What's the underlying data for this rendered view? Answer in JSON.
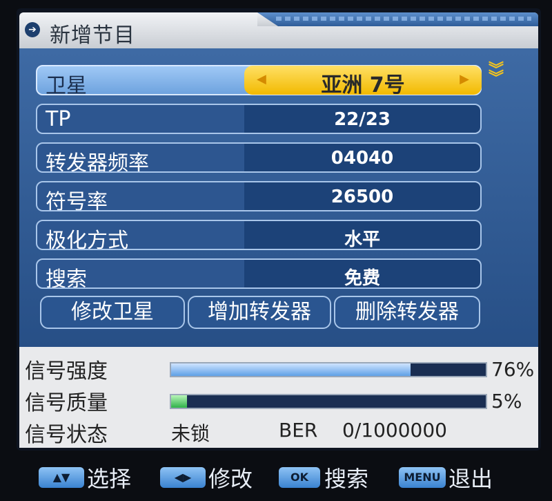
{
  "title": "新增节目",
  "rows": [
    {
      "label": "卫星",
      "value": "亚洲 7号"
    },
    {
      "label": "TP",
      "value": "22/23"
    },
    {
      "label": "转发器频率",
      "value": "04040"
    },
    {
      "label": "符号率",
      "value": "26500"
    },
    {
      "label": "极化方式",
      "value": "水平"
    },
    {
      "label": "搜索",
      "value": "免费"
    }
  ],
  "buttons": {
    "edit_satellite": "修改卫星",
    "add_transponder": "增加转发器",
    "delete_transponder": "删除转发器"
  },
  "signal": {
    "strength_label": "信号强度",
    "strength_pct": "76%",
    "strength_value": 0.76,
    "quality_label": "信号质量",
    "quality_pct": "5%",
    "quality_value": 0.05,
    "status_label": "信号状态",
    "status_value": "未锁",
    "ber_label": "BER",
    "ber_value": "0/1000000"
  },
  "footer": [
    {
      "key": "▲▼",
      "label": "选择"
    },
    {
      "key": "◀▶",
      "label": "修改"
    },
    {
      "key": "OK",
      "label": "搜索"
    },
    {
      "key": "MENU",
      "label": "退出"
    }
  ],
  "colors": {
    "selected": "#f2b900",
    "panel": "#274f86",
    "highlight": "#6ea3df"
  },
  "icons": {
    "title": "arrow-right-circle-icon",
    "more": "double-chevron-down-icon"
  }
}
